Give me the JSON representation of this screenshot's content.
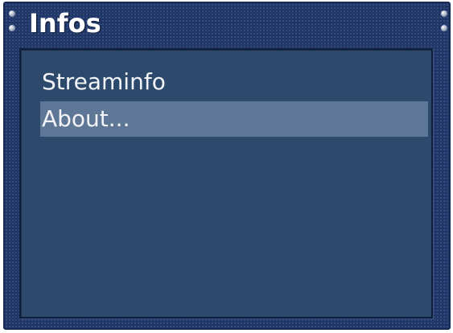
{
  "window": {
    "title": "Infos"
  },
  "menu": {
    "items": [
      {
        "label": "Streaminfo",
        "selected": false
      },
      {
        "label": "About...",
        "selected": true
      }
    ]
  },
  "colors": {
    "frame": "#20386b",
    "content_bg": "#2d4a6d",
    "selection": "#5f7796",
    "text": "#f2f4f7"
  }
}
